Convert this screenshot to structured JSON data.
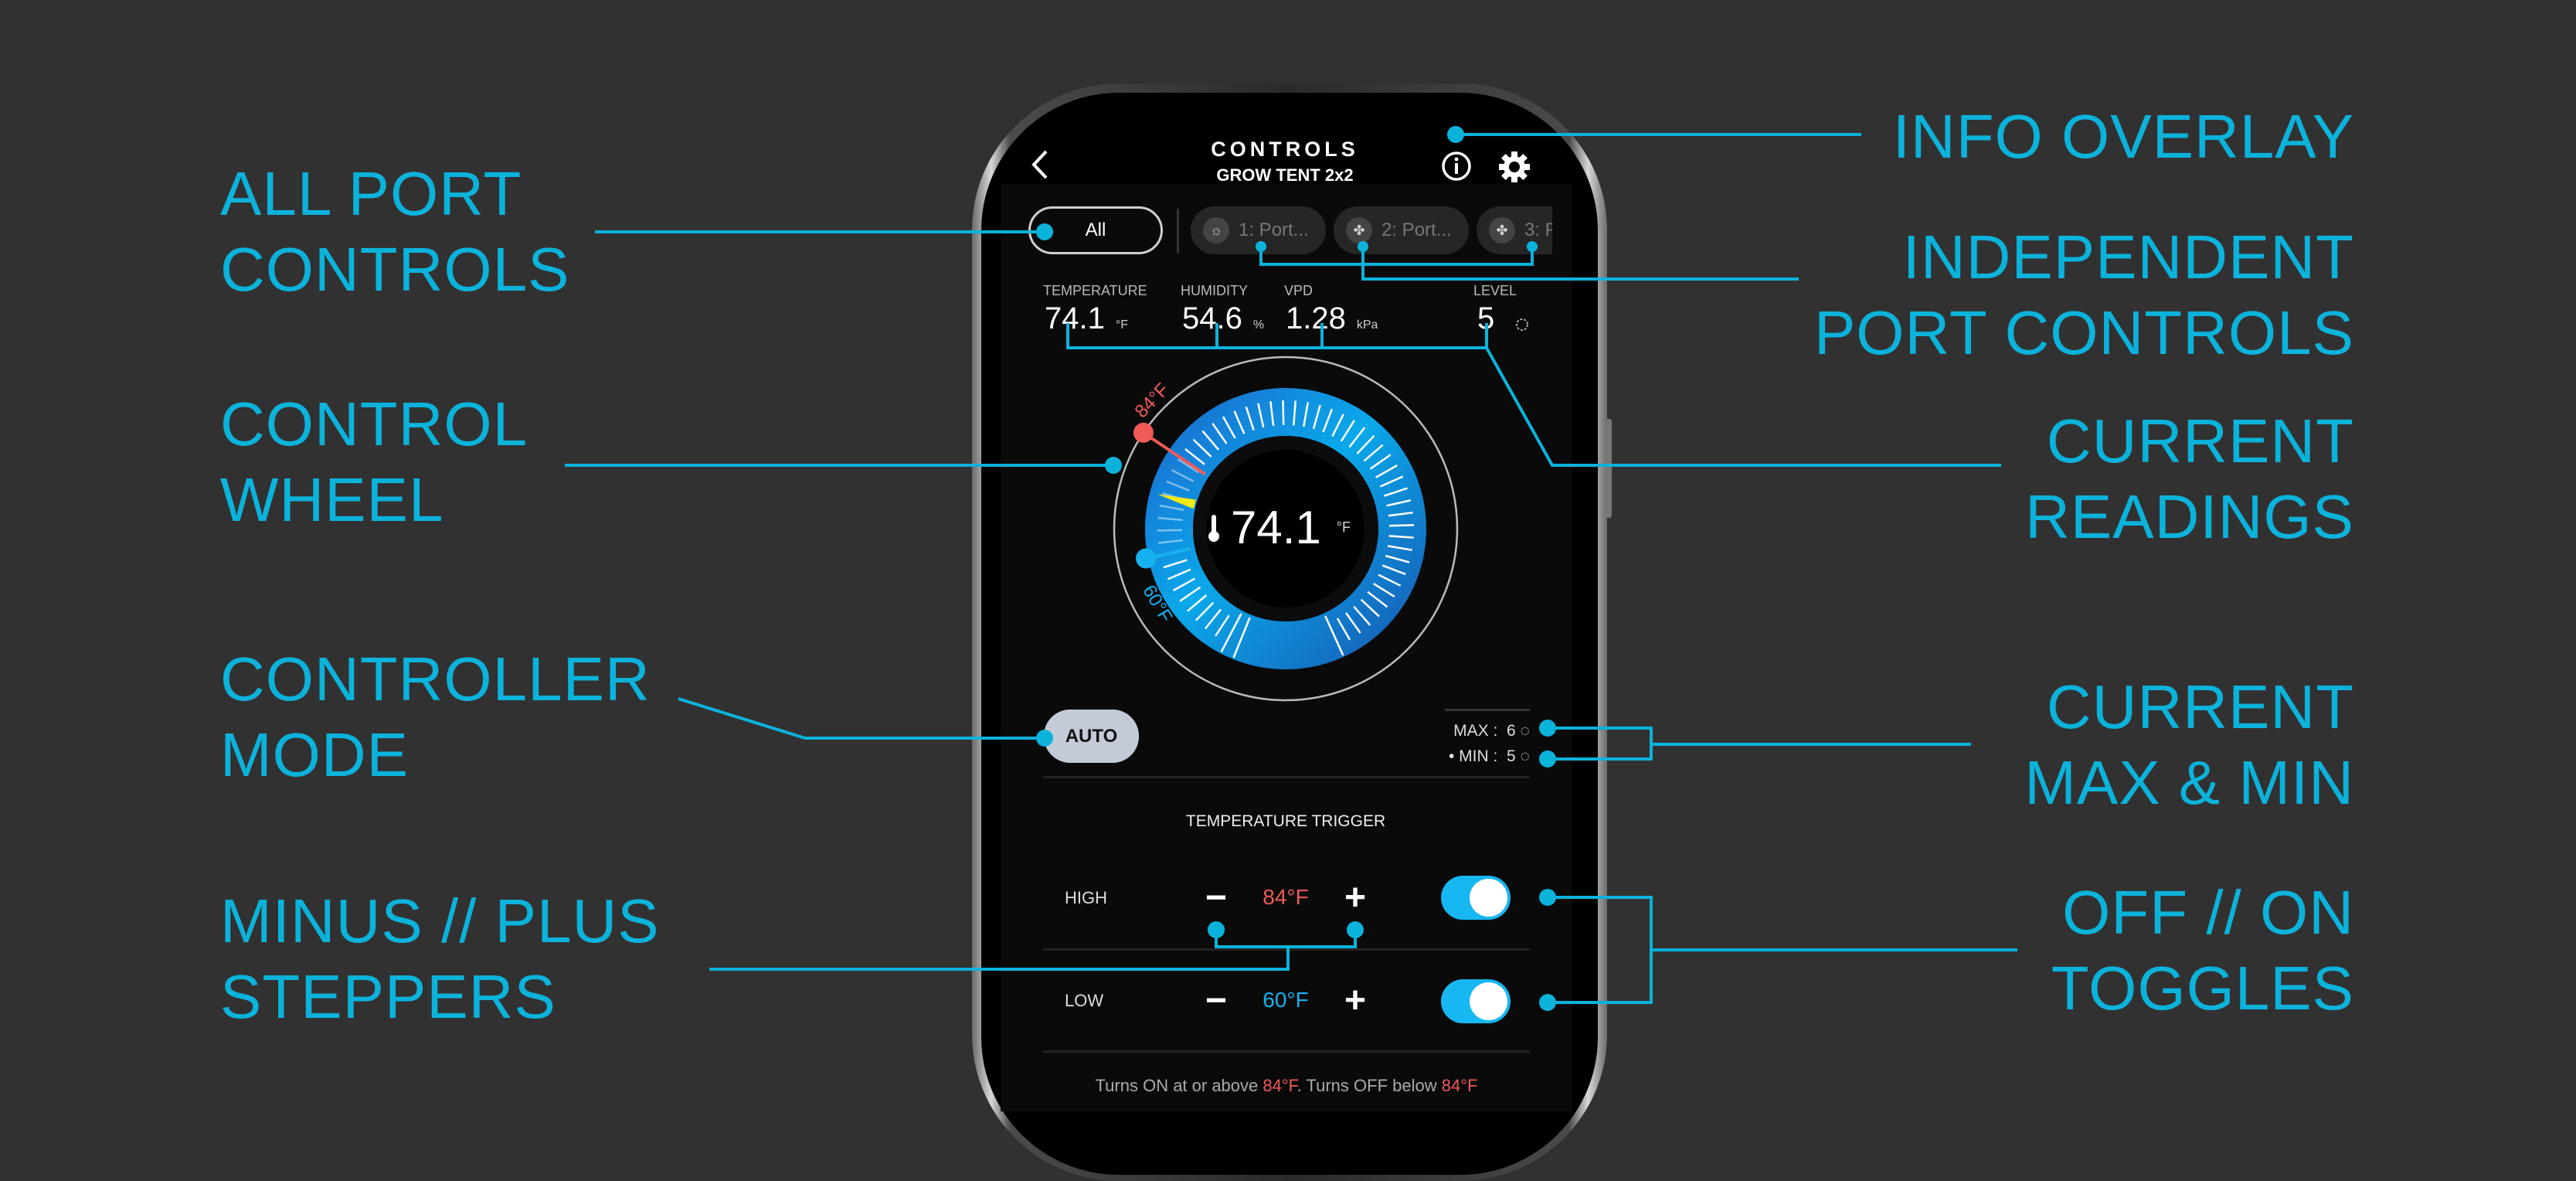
{
  "colors": {
    "annotation": "#0bb3db",
    "high": "#ef5a57",
    "low": "#16b2ef",
    "ring": "#1a8ae0",
    "toggle_on": "#17b7f2",
    "background": "#323132"
  },
  "annotations": {
    "info_overlay": "INFO OVERLAY",
    "all_port_controls": [
      "ALL PORT",
      "CONTROLS"
    ],
    "independent_port_controls": [
      "INDEPENDENT",
      "PORT CONTROLS"
    ],
    "control_wheel": [
      "CONTROL",
      "WHEEL"
    ],
    "current_readings": [
      "CURRENT",
      "READINGS"
    ],
    "controller_mode": [
      "CONTROLLER",
      "MODE"
    ],
    "current_max_min": [
      "CURRENT",
      "MAX & MIN"
    ],
    "minus_plus_steppers": [
      "MINUS // PLUS",
      "STEPPERS"
    ],
    "off_on_toggles": [
      "OFF // ON",
      "TOGGLES"
    ]
  },
  "header": {
    "title": "CONTROLS",
    "subtitle": "GROW TENT 2x2",
    "back_icon": "chevron-left-icon",
    "info_icon": "info-icon",
    "settings_icon": "gear-icon"
  },
  "tabs": [
    {
      "label": "All",
      "selected": true
    },
    {
      "label": "1: Port...",
      "icon": "grow-light-icon"
    },
    {
      "label": "2: Port...",
      "icon": "fan-icon"
    },
    {
      "label": "3: P",
      "icon": "fan-icon"
    }
  ],
  "readings": [
    {
      "label": "TEMPERATURE",
      "value": "74.1",
      "unit": "°F"
    },
    {
      "label": "HUMIDITY",
      "value": "54.6",
      "unit": "%"
    },
    {
      "label": "VPD",
      "value": "1.28",
      "unit": "kPa"
    },
    {
      "label": "LEVEL",
      "value": "5",
      "icon": "level-ring-icon"
    }
  ],
  "wheel": {
    "current": 74.1,
    "current_label": "74.1",
    "unit": "°F",
    "high": 84,
    "high_label": "84°F",
    "low": 60,
    "low_label": "60°F"
  },
  "mode": {
    "label": "AUTO"
  },
  "levels": {
    "max_label": "MAX :",
    "max": "6",
    "min_label": "MIN :",
    "min": "5",
    "min_active": true
  },
  "trigger": {
    "title": "TEMPERATURE TRIGGER",
    "rows": [
      {
        "label": "HIGH",
        "value": "84°F",
        "minus": "−",
        "plus": "+",
        "enabled": true
      },
      {
        "label": "LOW",
        "value": "60°F",
        "minus": "−",
        "plus": "+",
        "enabled": true
      }
    ]
  },
  "footer": {
    "part1": "Turns ON at or above ",
    "value1": "84°F",
    "part2": ". Turns OFF below ",
    "value2": "84°F"
  }
}
